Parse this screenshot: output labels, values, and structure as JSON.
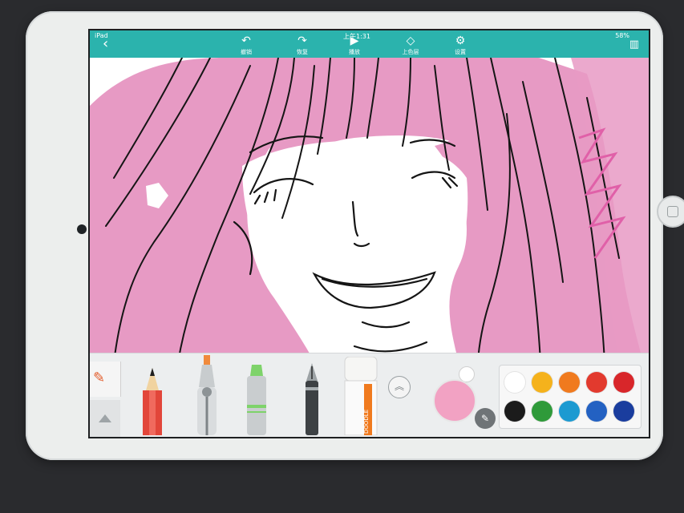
{
  "statusbar": {
    "carrier": "iPad",
    "time": "上午1:31",
    "battery": "58%"
  },
  "topbar": {
    "back_icon": "back-arrow-icon",
    "buttons": [
      {
        "label": "撤销",
        "icon": "undo-icon",
        "glyph": "↶"
      },
      {
        "label": "恢复",
        "icon": "redo-icon",
        "glyph": "↷"
      },
      {
        "label": "播放",
        "icon": "play-icon",
        "glyph": "▶"
      },
      {
        "label": "上色层",
        "icon": "layers-icon",
        "glyph": "◇"
      },
      {
        "label": "设置",
        "icon": "gear-icon",
        "glyph": "⚙"
      }
    ],
    "trash_icon": "trash-icon"
  },
  "toolbar": {
    "tools": [
      "brush-tab",
      "pencil",
      "compass-marker",
      "highlighter",
      "fountain-pen",
      "eraser"
    ],
    "eraser_label": "DOODLE",
    "expand_icon": "chevron-up-icon"
  },
  "colors": {
    "accent": "#2bb3ad",
    "current": "#f2a2c3",
    "hair_pink": "#e79ac4",
    "palette": [
      "#ffffff",
      "#f5b21c",
      "#f07a1e",
      "#e23a2e",
      "#d8262a",
      "#1b1b1b",
      "#2f9a3a",
      "#1c9ad1",
      "#2361c2",
      "#1a3d9e"
    ]
  }
}
